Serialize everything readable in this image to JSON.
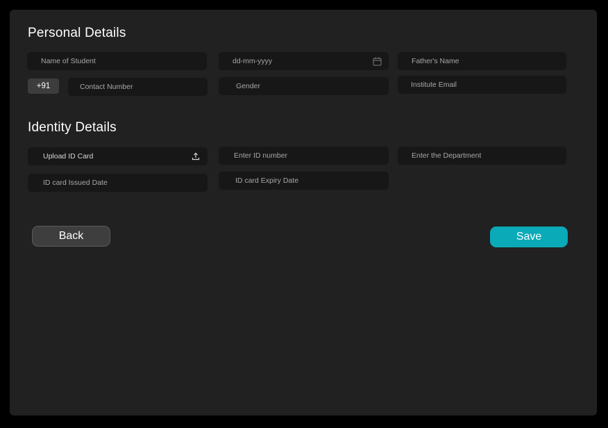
{
  "personal": {
    "title": "Personal Details",
    "name_placeholder": "Name of Student",
    "dob_placeholder": "dd-mm-yyyy",
    "father_placeholder": "Father's Name",
    "country_code": "+91",
    "contact_placeholder": "Contact Number",
    "gender_placeholder": "Gender",
    "email_placeholder": "Institute Email"
  },
  "identity": {
    "title": "Identity Details",
    "upload_label": "Upload ID Card",
    "id_number_placeholder": "Enter ID number",
    "department_placeholder": "Enter the Department",
    "issued_placeholder": "ID card Issued Date",
    "expiry_placeholder": "ID card Expiry Date"
  },
  "actions": {
    "back_label": "Back",
    "save_label": "Save"
  },
  "icons": {
    "calendar": "calendar-icon",
    "upload": "upload-icon"
  },
  "colors": {
    "background": "#000000",
    "panel": "#212121",
    "field": "#171717",
    "accent": "#0aaab8",
    "back_button": "#3e3e3e"
  }
}
